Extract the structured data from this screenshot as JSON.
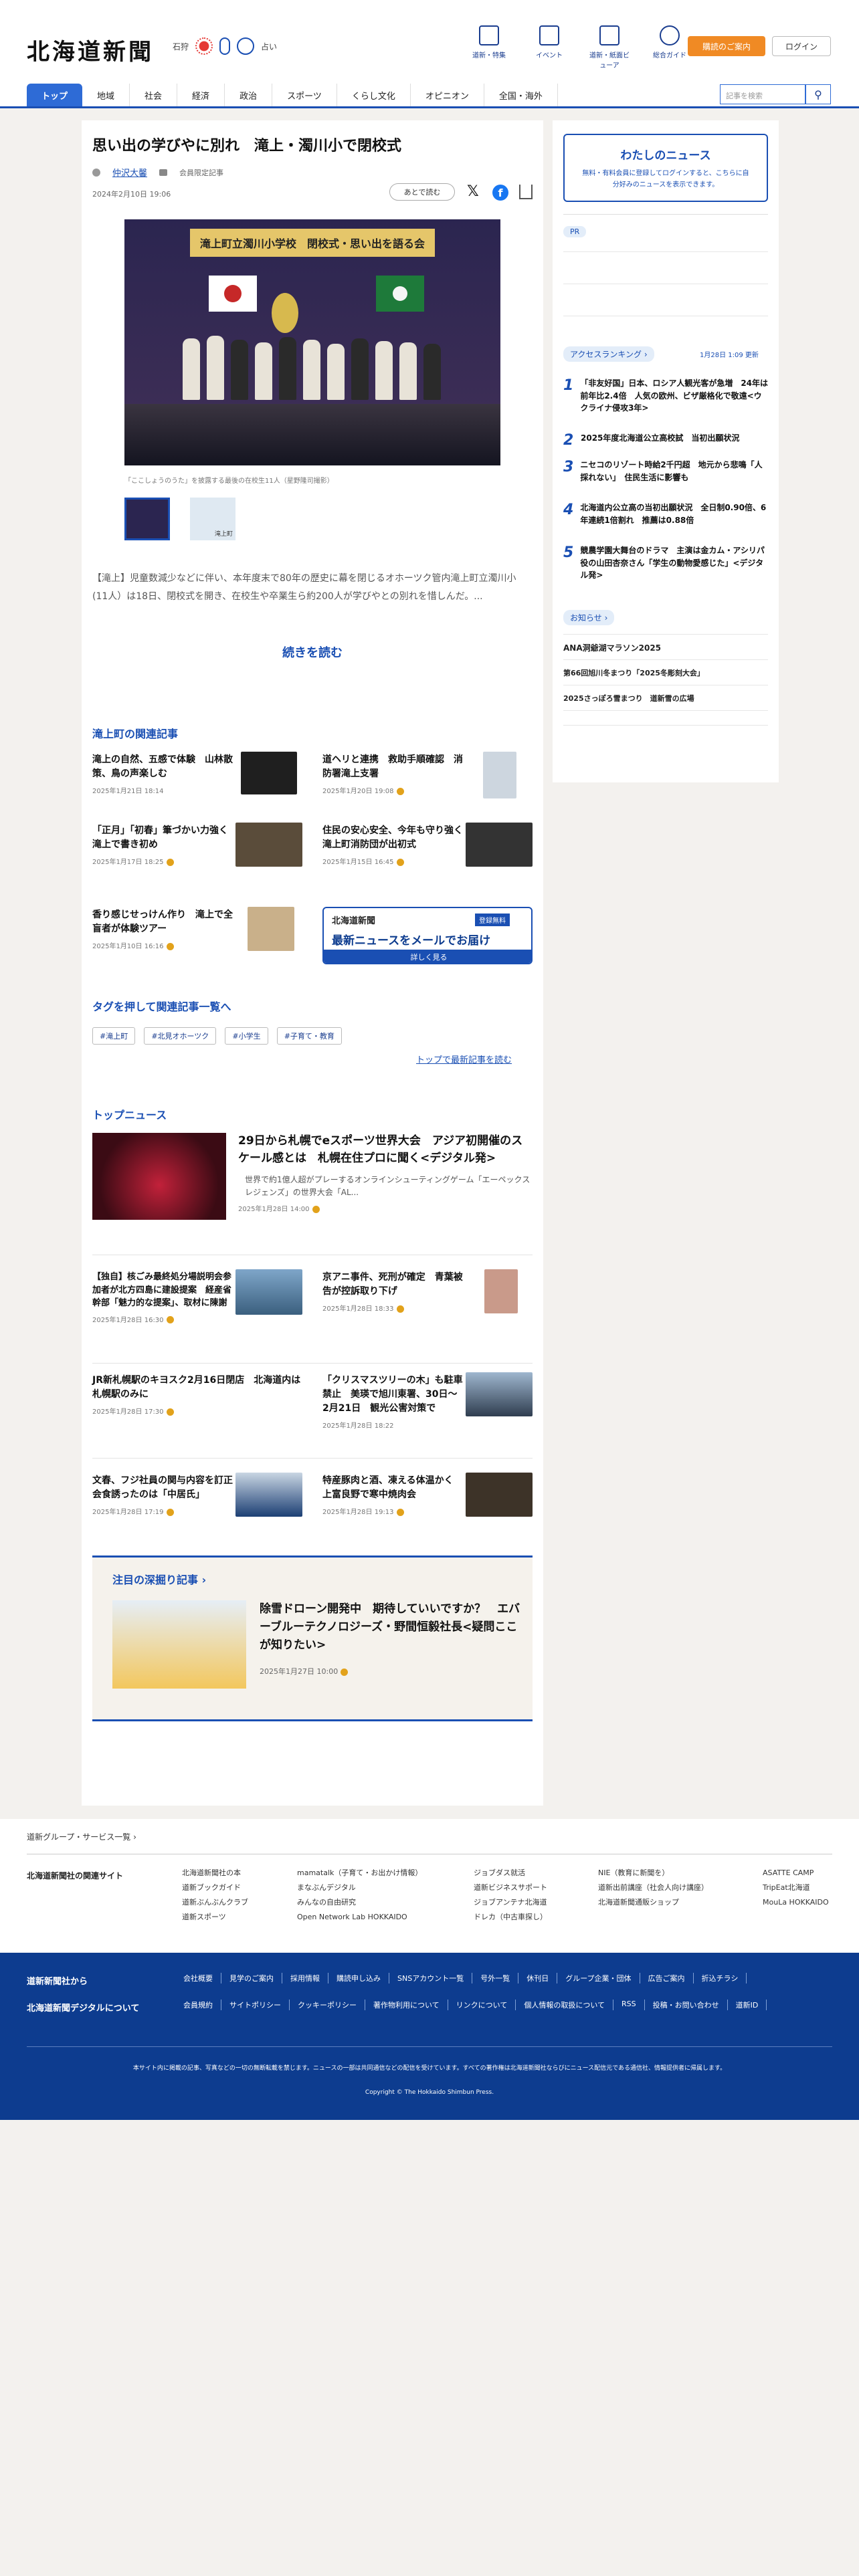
{
  "header": {
    "logo": "北海道新聞",
    "weather_city": "石狩",
    "weather_note": "占い",
    "nav": [
      "道新・特集",
      "イベント",
      "道新・紙面ビューア",
      "総合ガイド"
    ],
    "cta": "購読のご案内",
    "login": "ログイン",
    "search_placeholder": "記事を検索"
  },
  "menu": [
    "トップ",
    "地域",
    "社会",
    "経済",
    "政治",
    "スポーツ",
    "くらし文化",
    "オピニオン",
    "全国・海外"
  ],
  "article": {
    "title": "思い出の学びやに別れ　滝上・濁川小で閉校式",
    "author": "仲沢大馨",
    "member_label": "会員限定記事",
    "date": "2024年2月10日 19:06",
    "read_later": "あとで読む",
    "photo_banner": "滝上町立濁川小学校　閉校式・思い出を語る会",
    "caption": "「ここしょうのうた」を披露する最後の在校生11人（星野隆司撮影）",
    "thumb2_label": "滝上町",
    "lead": "【滝上】児童数減少などに伴い、本年度末で80年の歴史に幕を閉じるオホーツク管内滝上町立濁川小(11人）は18日、閉校式を開き、在校生や卒業生ら約200人が学びやとの別れを惜しんだ。...",
    "read_more": "続きを読む"
  },
  "related": {
    "title": "滝上町の関連記事",
    "items": [
      {
        "title": "滝上の自然、五感で体験　山林散策、鳥の声楽しむ",
        "date": "2025年1月21日 18:14"
      },
      {
        "title": "道ヘリと連携　救助手順確認　消防署滝上支署",
        "date": "2025年1月20日 19:08"
      },
      {
        "title": "「正月」「初春」筆づかい力強く　滝上で書き初め",
        "date": "2025年1月17日 18:25"
      },
      {
        "title": "住民の安心安全、今年も守り強く　滝上町消防団が出初式",
        "date": "2025年1月15日 16:45"
      },
      {
        "title": "香り感じせっけん作り　滝上で全盲者が体験ツアー",
        "date": "2025年1月10日 16:16"
      }
    ],
    "mail_brand": "北海道新聞",
    "mail_free": "登録無料",
    "mail_title": "最新ニュースをメールでお届け",
    "mail_button": "詳しく見る"
  },
  "tags": {
    "title": "タグを押して関連記事一覧へ",
    "items": [
      "#滝上町",
      "#北見オホーツク",
      "#小学生",
      "#子育て・教育"
    ],
    "latest_link": "トップで最新記事を読む"
  },
  "top_news": {
    "title": "トップニュース",
    "lead_title": "29日から札幌でeスポーツ世界大会　アジア初開催のスケール感とは　札幌在住プロに聞く<デジタル発>",
    "lead_body": "世界で約1億人超がプレーするオンラインシューティングゲーム「エーペックスレジェンズ」の世界大会「AL...",
    "lead_date": "2025年1月28日 14:00",
    "items": [
      {
        "title": "【独自】核ごみ最終処分場説明会参加者が北方四島に建設提案　経産省幹部「魅力的な提案」、取材に陳謝",
        "date": "2025年1月28日 16:30"
      },
      {
        "title": "京アニ事件、死刑が確定　青葉被告が控訴取り下げ",
        "date": "2025年1月28日 18:33"
      },
      {
        "title": "JR新札幌駅のキヨスク2月16日閉店　北海道内は札幌駅のみに",
        "date": "2025年1月28日 17:30"
      },
      {
        "title": "「クリスマスツリーの木」も駐車禁止　美瑛で旭川東署、30日～2月21日　観光公害対策で",
        "date": "2025年1月28日 18:22"
      },
      {
        "title": "文春、フジ社員の関与内容を訂正　会食誘ったのは「中居氏」",
        "date": "2025年1月28日 17:19"
      },
      {
        "title": "特産豚肉と酒、凍える体温かく　上富良野で寒中焼肉会",
        "date": "2025年1月28日 19:13"
      }
    ]
  },
  "feature": {
    "label": "注目の深掘り記事",
    "title": "除雪ドローン開発中　期待していいですか？　エバーブルーテクノロジーズ・野間恒毅社長<疑問ここが知りたい>",
    "date": "2025年1月27日 10:00"
  },
  "sidebar": {
    "my_news_title": "わたしのニュース",
    "my_news_text": "無料・有料会員に登録してログインすると、こちらに自分好みのニュースを表示できます。",
    "pr": "PR",
    "ranking_title": "アクセスランキング",
    "ranking_updated": "1月28日 1:09 更新",
    "ranking": [
      "「非友好国」日本、ロシア人観光客が急増　24年は前年比2.4倍　人気の欧州、ビザ厳格化で敬遠<ウクライナ侵攻3年>",
      "2025年度北海道公立高校試　当初出願状況",
      "ニセコのリゾート時給2千円超　地元から悲鳴「人採れない」　住民生活に影響も",
      "北海道内公立高の当初出願状況　全日制0.90倍、6年連続1倍割れ　推薦は0.88倍",
      "競農学園大舞台のドラマ　主演は金カム・アシリパ役の山田杏奈さん「学生の動物愛感じた」<デジタル発>"
    ],
    "notice_title": "お知らせ",
    "notices": [
      "ANA洞爺湖マラソン2025",
      "第66回旭川冬まつり「2025冬彫刻大会」",
      "2025さっぽろ雪まつり　道新雪の広場"
    ]
  },
  "footer": {
    "group_label": "道新グループ・サービス一覧",
    "related_title": "北海道新聞社の関連サイト",
    "sites": [
      [
        "北海道新聞社の本",
        "道新ブックガイド",
        "道新ぶんぶんクラブ",
        "道新スポーツ"
      ],
      [
        "mamatalk（子育て・お出かけ情報）",
        "まなぶんデジタル",
        "みんなの自由研究",
        "Open Network Lab HOKKAIDO"
      ],
      [
        "ジョブダス就活",
        "道新ビジネスサポート",
        "ジョブアンテナ北海道",
        "ドレカ（中古車探し）"
      ],
      [
        "NIE（教育に新聞を）",
        "道新出前講座（社会人向け講座）",
        "北海道新聞通販ショップ"
      ],
      [
        "ASATTE CAMP",
        "TripEat北海道",
        "MouLa HOKKAIDO"
      ]
    ],
    "about_label": "道新新聞社から",
    "digital_label": "北海道新聞デジタルについて",
    "links1": [
      "会社概要",
      "見学のご案内",
      "採用情報",
      "購読申し込み",
      "SNSアカウント一覧",
      "号外一覧",
      "休刊日",
      "グループ企業・団体",
      "広告ご案内",
      "折込チラシ"
    ],
    "links2": [
      "会員規約",
      "サイトポリシー",
      "クッキーポリシー",
      "著作物利用について",
      "リンクについて",
      "個人情報の取扱について",
      "RSS",
      "投稿・お問い合わせ",
      "道新ID"
    ],
    "notice": "本サイト内に掲載の記事、写真などの一切の無断転載を禁じます。ニュースの一部は共同通信などの配信を受けています。すべての著作権は北海道新聞社ならびにニュース配信元である通信社、情報提供者に帰属します。",
    "copyright": "Copyright © The Hokkaido Shimbun Press."
  }
}
